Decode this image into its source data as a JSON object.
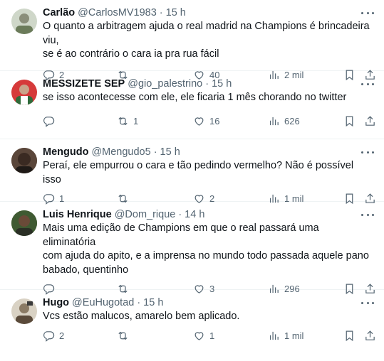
{
  "tweets": [
    {
      "name": "Carlão",
      "handle": "@CarlosMV1983",
      "time": "15 h",
      "text_lines": [
        "O quanto a arbitragem ajuda o real madrid na Champions é brincadeira viu,",
        "se é ao contrário o cara ia pra rua fácil"
      ],
      "replies": "2",
      "retweets": "",
      "likes": "40",
      "views": "2 mil",
      "avatar_colors": [
        "#cfd7c9",
        "#6b7b5a"
      ]
    },
    {
      "name": "MESSIZETE SEP",
      "handle": "@gio_palestrino",
      "time": "15 h",
      "text_lines": [
        "se isso acontecesse com ele, ele ficaria 1 mês chorando no twitter"
      ],
      "replies": "",
      "retweets": "1",
      "likes": "16",
      "views": "626",
      "avatar_colors": [
        "#d63a3a",
        "#2f6b3a"
      ]
    },
    {
      "name": "Mengudo",
      "handle": "@Mengudo5",
      "time": "15 h",
      "text_lines": [
        "Peraí, ele empurrou o cara e tão pedindo vermelho? Não é possível isso"
      ],
      "replies": "1",
      "retweets": "",
      "likes": "2",
      "views": "1 mil",
      "avatar_colors": [
        "#3a2a22",
        "#7a5a44"
      ]
    },
    {
      "name": "Luis Henrique",
      "handle": "@Dom_rique",
      "time": "14 h",
      "text_lines": [
        "Mais uma edição de Champions em que o real passará uma eliminatória",
        "com ajuda do apito, e a imprensa no mundo todo passada aquele pano",
        "babado, quentinho"
      ],
      "replies": "",
      "retweets": "",
      "likes": "3",
      "views": "296",
      "avatar_colors": [
        "#4c6a3c",
        "#2a2f25"
      ]
    },
    {
      "name": "Hugo",
      "handle": "@EuHugotad",
      "time": "15 h",
      "text_lines": [
        "Vcs estão malucos, amarelo bem aplicado."
      ],
      "replies": "2",
      "retweets": "",
      "likes": "1",
      "views": "1 mil",
      "avatar_colors": [
        "#d9d2c4",
        "#5a4a3a"
      ]
    }
  ],
  "icons": {
    "more": "more-icon",
    "reply": "reply-icon",
    "retweet": "retweet-icon",
    "like": "like-icon",
    "views": "views-icon",
    "bookmark": "bookmark-icon",
    "share": "share-icon"
  },
  "separator_dot": "·",
  "colors": {
    "text": "#0f1419",
    "muted": "#536471",
    "divider": "#eff3f4"
  }
}
